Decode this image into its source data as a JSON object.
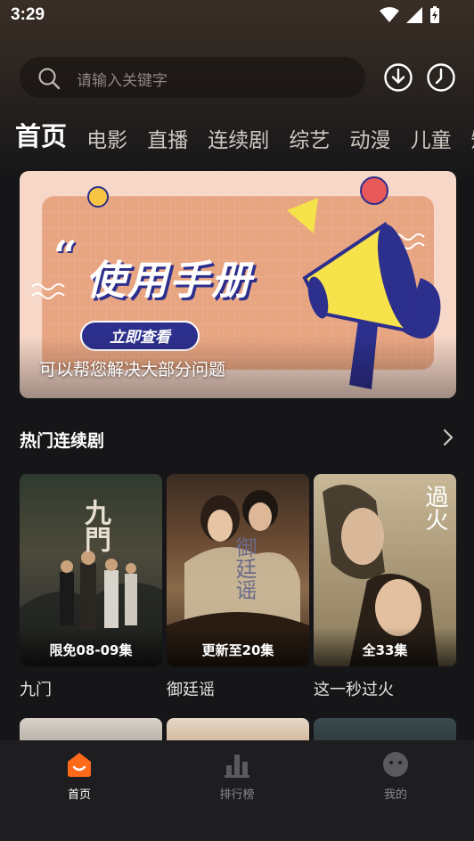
{
  "status_bar": {
    "time": "3:29"
  },
  "search": {
    "placeholder": "请输入关键字"
  },
  "tabs": [
    {
      "label": "首页",
      "active": true
    },
    {
      "label": "电影"
    },
    {
      "label": "直播"
    },
    {
      "label": "连续剧"
    },
    {
      "label": "综艺"
    },
    {
      "label": "动漫"
    },
    {
      "label": "儿童"
    },
    {
      "label": "短"
    }
  ],
  "banner": {
    "title": "使用手册",
    "button_label": "立即查看",
    "subtitle": "可以帮您解决大部分问题"
  },
  "section": {
    "title": "热门连续剧"
  },
  "posters": [
    {
      "title": "九门",
      "badge": "限免08-09集",
      "poster_text": "九門"
    },
    {
      "title": "御廷谣",
      "badge": "更新至20集",
      "poster_text": "御廷谣"
    },
    {
      "title": "这一秒过火",
      "badge": "全33集",
      "poster_text": "過火"
    }
  ],
  "bottom_nav": [
    {
      "label": "首页",
      "icon": "home-face-icon",
      "active": true,
      "color": "#ff6a1a"
    },
    {
      "label": "排行榜",
      "icon": "bar-chart-icon"
    },
    {
      "label": "我的",
      "icon": "profile-face-icon"
    }
  ],
  "colors": {
    "accent": "#ff6a1a",
    "background": "#161618",
    "nav_background": "#1e1e21"
  }
}
